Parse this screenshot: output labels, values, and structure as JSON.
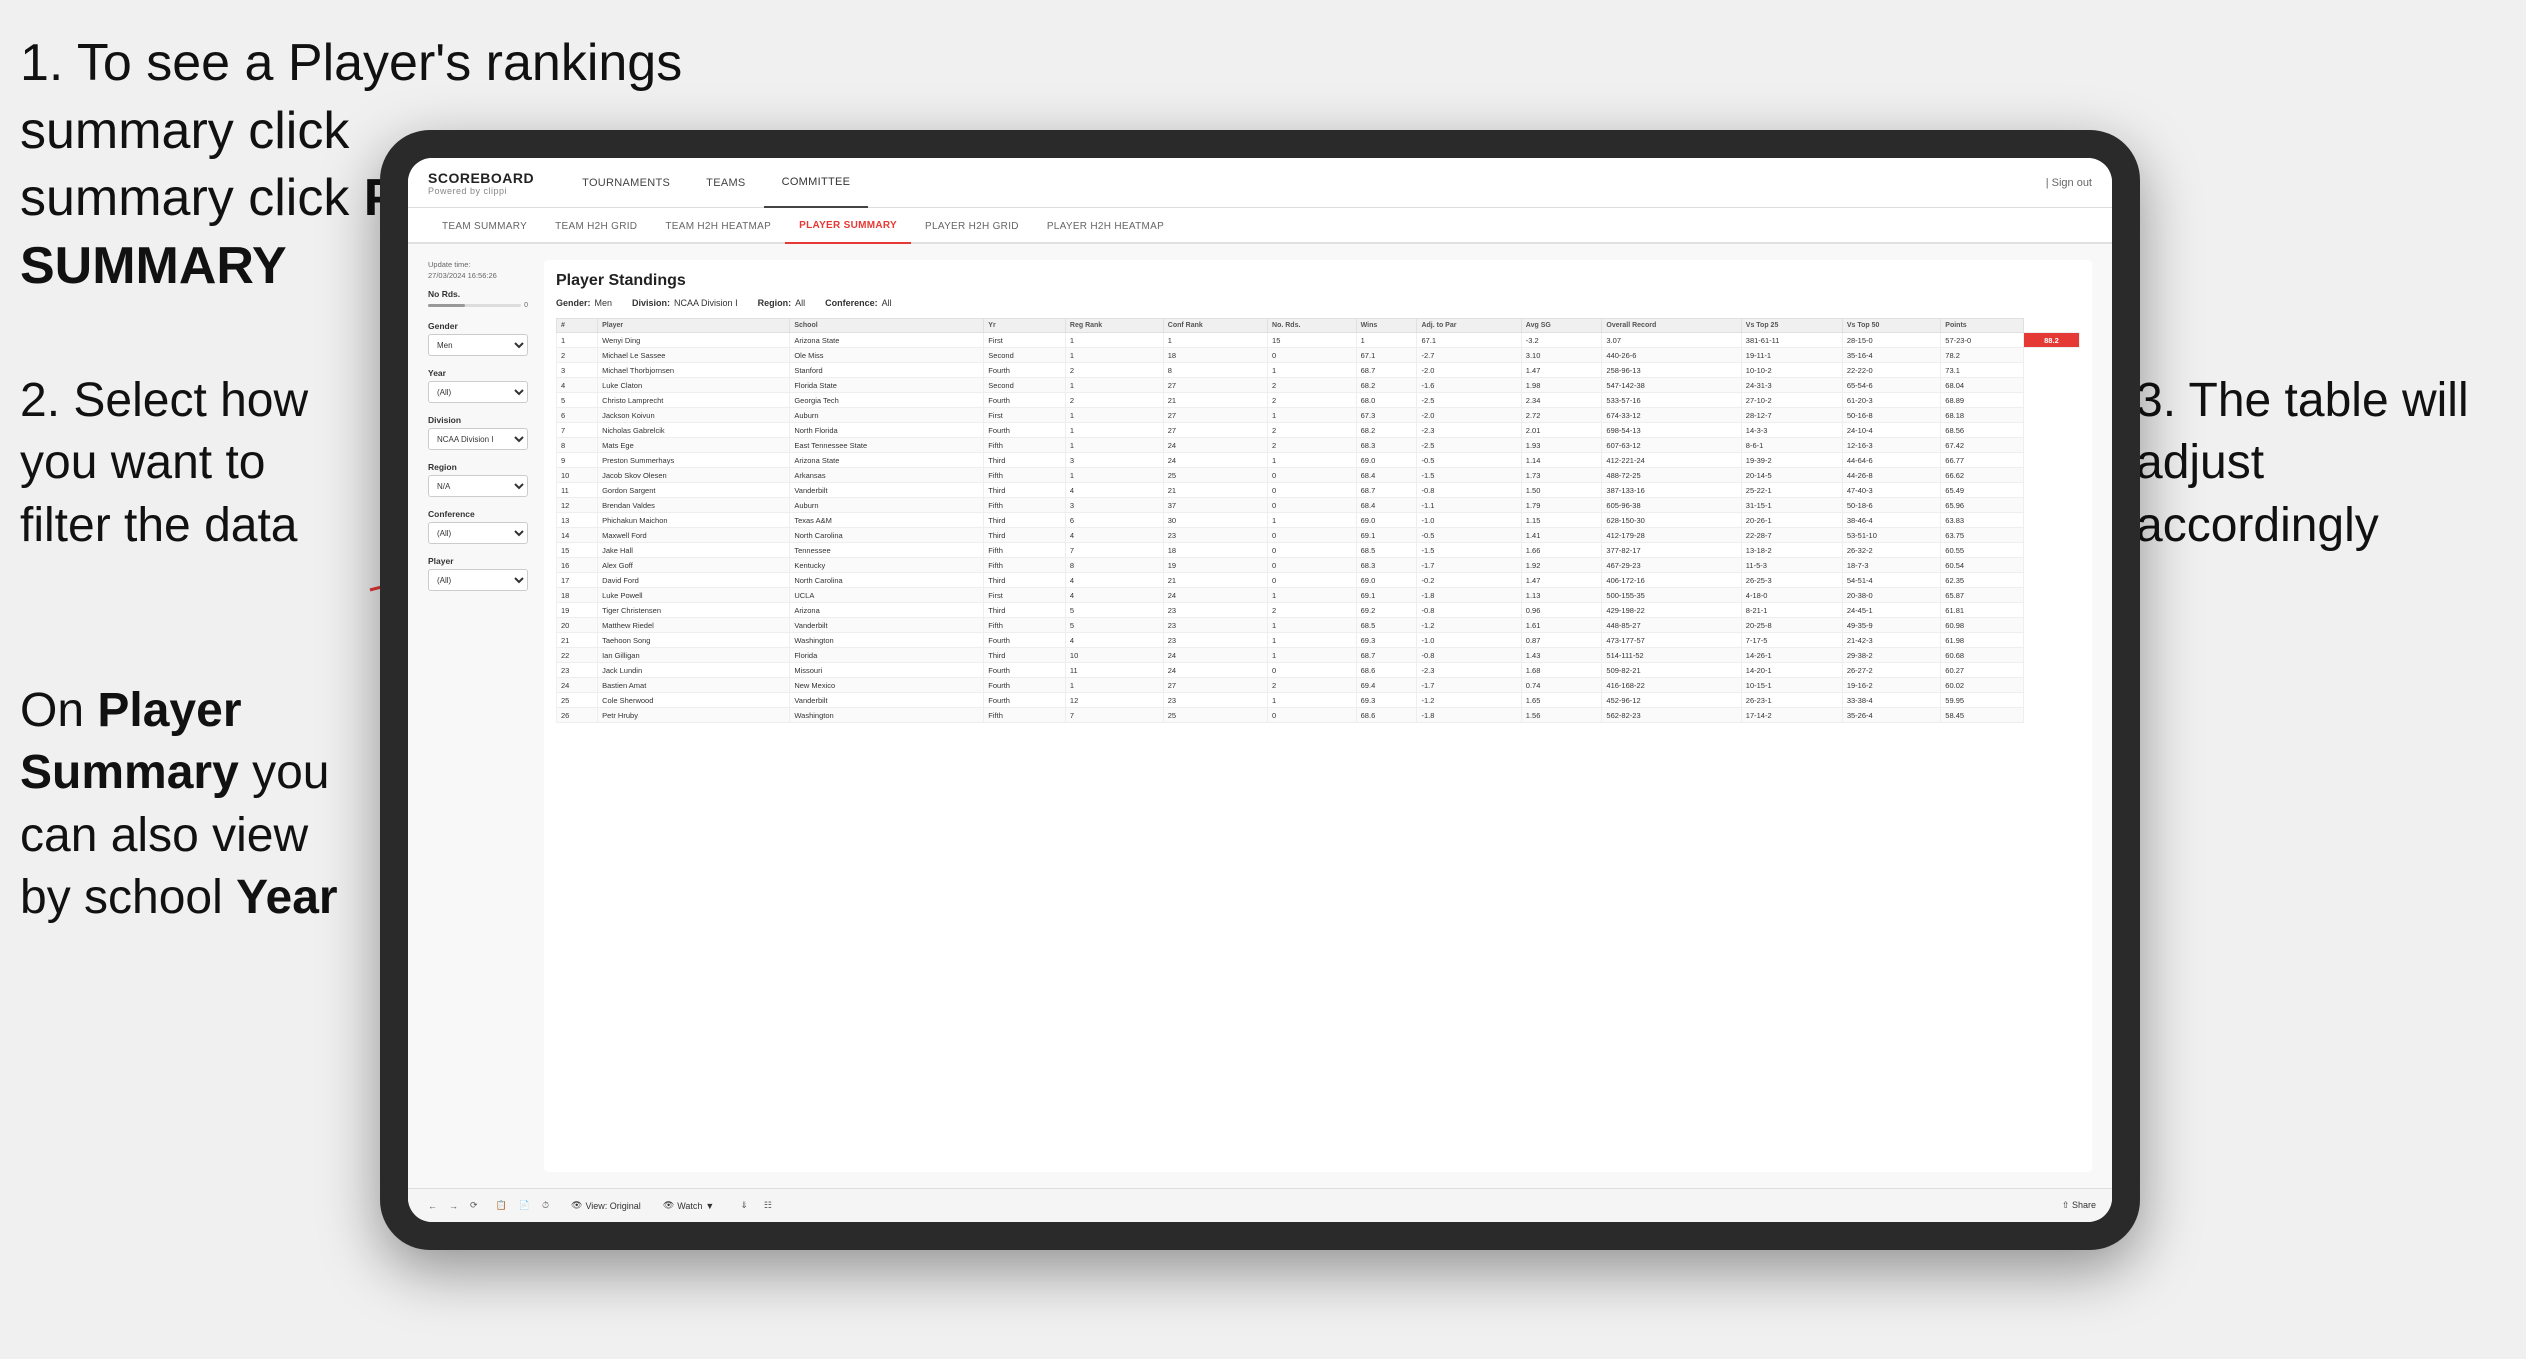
{
  "instructions": {
    "step1": "1. To see a Player's rankings summary click ",
    "step1_bold": "PLAYER SUMMARY",
    "step2_title": "2. Select how you want to filter the data",
    "step3_title": "3. The table will adjust accordingly",
    "step4_title": "On ",
    "step4_bold1": "Player Summary",
    "step4_text": " you can also view by school ",
    "step4_bold2": "Year"
  },
  "app": {
    "logo": "SCOREBOARD",
    "logo_sub": "Powered by clippi",
    "nav": [
      "TOURNAMENTS",
      "TEAMS",
      "COMMITTEE"
    ],
    "sign_out": "Sign out",
    "sub_nav": [
      "TEAM SUMMARY",
      "TEAM H2H GRID",
      "TEAM H2H HEATMAP",
      "PLAYER SUMMARY",
      "PLAYER H2H GRID",
      "PLAYER H2H HEATMAP"
    ]
  },
  "filters": {
    "update_time_label": "Update time:",
    "update_time_value": "27/03/2024 16:56:26",
    "no_rds_label": "No Rds.",
    "gender_label": "Gender",
    "gender_value": "Men",
    "year_label": "Year",
    "year_value": "(All)",
    "division_label": "Division",
    "division_value": "NCAA Division I",
    "region_label": "Region",
    "region_value": "N/A",
    "conference_label": "Conference",
    "conference_value": "(All)",
    "player_label": "Player",
    "player_value": "(All)"
  },
  "table": {
    "title": "Player Standings",
    "gender_label": "Gender:",
    "gender_value": "Men",
    "division_label": "Division:",
    "division_value": "NCAA Division I",
    "region_label": "Region:",
    "region_value": "All",
    "conference_label": "Conference:",
    "conference_value": "All",
    "columns": [
      "#",
      "Player",
      "School",
      "Yr",
      "Reg Rank",
      "Conf Rank",
      "No. Rds.",
      "Wins",
      "Adj. to Par",
      "Avg SG",
      "Overall Record",
      "Vs Top 25",
      "Vs Top 50",
      "Points"
    ],
    "rows": [
      [
        "1",
        "Wenyi Ding",
        "Arizona State",
        "First",
        "1",
        "1",
        "15",
        "1",
        "67.1",
        "-3.2",
        "3.07",
        "381-61-11",
        "28-15-0",
        "57-23-0",
        "88.2"
      ],
      [
        "2",
        "Michael Le Sassee",
        "Ole Miss",
        "Second",
        "1",
        "18",
        "0",
        "67.1",
        "-2.7",
        "3.10",
        "440-26-6",
        "19-11-1",
        "35-16-4",
        "78.2"
      ],
      [
        "3",
        "Michael Thorbjornsen",
        "Stanford",
        "Fourth",
        "2",
        "8",
        "1",
        "68.7",
        "-2.0",
        "1.47",
        "258-96-13",
        "10-10-2",
        "22-22-0",
        "73.1"
      ],
      [
        "4",
        "Luke Claton",
        "Florida State",
        "Second",
        "1",
        "27",
        "2",
        "68.2",
        "-1.6",
        "1.98",
        "547-142-38",
        "24-31-3",
        "65-54-6",
        "68.04"
      ],
      [
        "5",
        "Christo Lamprecht",
        "Georgia Tech",
        "Fourth",
        "2",
        "21",
        "2",
        "68.0",
        "-2.5",
        "2.34",
        "533-57-16",
        "27-10-2",
        "61-20-3",
        "68.89"
      ],
      [
        "6",
        "Jackson Koivun",
        "Auburn",
        "First",
        "1",
        "27",
        "1",
        "67.3",
        "-2.0",
        "2.72",
        "674-33-12",
        "28-12-7",
        "50-16-8",
        "68.18"
      ],
      [
        "7",
        "Nicholas Gabrelcik",
        "North Florida",
        "Fourth",
        "1",
        "27",
        "2",
        "68.2",
        "-2.3",
        "2.01",
        "698-54-13",
        "14-3-3",
        "24-10-4",
        "68.56"
      ],
      [
        "8",
        "Mats Ege",
        "East Tennessee State",
        "Fifth",
        "1",
        "24",
        "2",
        "68.3",
        "-2.5",
        "1.93",
        "607-63-12",
        "8-6-1",
        "12-16-3",
        "67.42"
      ],
      [
        "9",
        "Preston Summerhays",
        "Arizona State",
        "Third",
        "3",
        "24",
        "1",
        "69.0",
        "-0.5",
        "1.14",
        "412-221-24",
        "19-39-2",
        "44-64-6",
        "66.77"
      ],
      [
        "10",
        "Jacob Skov Olesen",
        "Arkansas",
        "Fifth",
        "1",
        "25",
        "0",
        "68.4",
        "-1.5",
        "1.73",
        "488-72-25",
        "20-14-5",
        "44-26-8",
        "66.62"
      ],
      [
        "11",
        "Gordon Sargent",
        "Vanderbilt",
        "Third",
        "4",
        "21",
        "0",
        "68.7",
        "-0.8",
        "1.50",
        "387-133-16",
        "25-22-1",
        "47-40-3",
        "65.49"
      ],
      [
        "12",
        "Brendan Valdes",
        "Auburn",
        "Fifth",
        "3",
        "37",
        "0",
        "68.4",
        "-1.1",
        "1.79",
        "605-96-38",
        "31-15-1",
        "50-18-6",
        "65.96"
      ],
      [
        "13",
        "Phichakun Maichon",
        "Texas A&M",
        "Third",
        "6",
        "30",
        "1",
        "69.0",
        "-1.0",
        "1.15",
        "628-150-30",
        "20-26-1",
        "38-46-4",
        "63.83"
      ],
      [
        "14",
        "Maxwell Ford",
        "North Carolina",
        "Third",
        "4",
        "23",
        "0",
        "69.1",
        "-0.5",
        "1.41",
        "412-179-28",
        "22-28-7",
        "53-51-10",
        "63.75"
      ],
      [
        "15",
        "Jake Hall",
        "Tennessee",
        "Fifth",
        "7",
        "18",
        "0",
        "68.5",
        "-1.5",
        "1.66",
        "377-82-17",
        "13-18-2",
        "26-32-2",
        "60.55"
      ],
      [
        "16",
        "Alex Goff",
        "Kentucky",
        "Fifth",
        "8",
        "19",
        "0",
        "68.3",
        "-1.7",
        "1.92",
        "467-29-23",
        "11-5-3",
        "18-7-3",
        "60.54"
      ],
      [
        "17",
        "David Ford",
        "North Carolina",
        "Third",
        "4",
        "21",
        "0",
        "69.0",
        "-0.2",
        "1.47",
        "406-172-16",
        "26-25-3",
        "54-51-4",
        "62.35"
      ],
      [
        "18",
        "Luke Powell",
        "UCLA",
        "First",
        "4",
        "24",
        "1",
        "69.1",
        "-1.8",
        "1.13",
        "500-155-35",
        "4-18-0",
        "20-38-0",
        "65.87"
      ],
      [
        "19",
        "Tiger Christensen",
        "Arizona",
        "Third",
        "5",
        "23",
        "2",
        "69.2",
        "-0.8",
        "0.96",
        "429-198-22",
        "8-21-1",
        "24-45-1",
        "61.81"
      ],
      [
        "20",
        "Matthew Riedel",
        "Vanderbilt",
        "Fifth",
        "5",
        "23",
        "1",
        "68.5",
        "-1.2",
        "1.61",
        "448-85-27",
        "20-25-8",
        "49-35-9",
        "60.98"
      ],
      [
        "21",
        "Taehoon Song",
        "Washington",
        "Fourth",
        "4",
        "23",
        "1",
        "69.3",
        "-1.0",
        "0.87",
        "473-177-57",
        "7-17-5",
        "21-42-3",
        "61.98"
      ],
      [
        "22",
        "Ian Gilligan",
        "Florida",
        "Third",
        "10",
        "24",
        "1",
        "68.7",
        "-0.8",
        "1.43",
        "514-111-52",
        "14-26-1",
        "29-38-2",
        "60.68"
      ],
      [
        "23",
        "Jack Lundin",
        "Missouri",
        "Fourth",
        "11",
        "24",
        "0",
        "68.6",
        "-2.3",
        "1.68",
        "509-82-21",
        "14-20-1",
        "26-27-2",
        "60.27"
      ],
      [
        "24",
        "Bastien Amat",
        "New Mexico",
        "Fourth",
        "1",
        "27",
        "2",
        "69.4",
        "-1.7",
        "0.74",
        "416-168-22",
        "10-15-1",
        "19-16-2",
        "60.02"
      ],
      [
        "25",
        "Cole Sherwood",
        "Vanderbilt",
        "Fourth",
        "12",
        "23",
        "1",
        "69.3",
        "-1.2",
        "1.65",
        "452-96-12",
        "26-23-1",
        "33-38-4",
        "59.95"
      ],
      [
        "26",
        "Petr Hruby",
        "Washington",
        "Fifth",
        "7",
        "25",
        "0",
        "68.6",
        "-1.8",
        "1.56",
        "562-82-23",
        "17-14-2",
        "35-26-4",
        "58.45"
      ]
    ]
  },
  "toolbar": {
    "view_original": "View: Original",
    "watch": "Watch",
    "share": "Share"
  }
}
